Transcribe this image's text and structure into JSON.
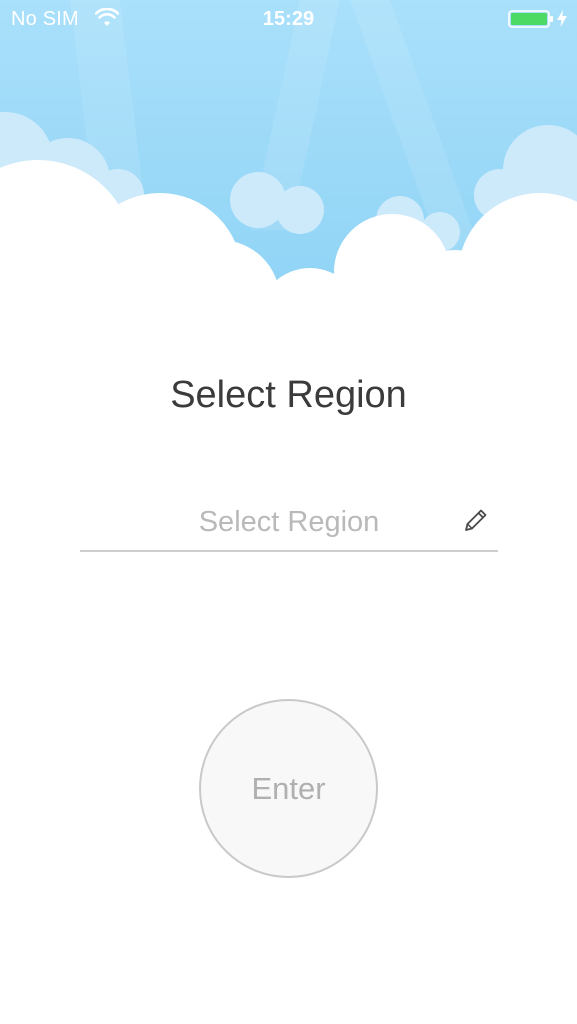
{
  "status_bar": {
    "carrier": "No SIM",
    "time": "15:29",
    "wifi_icon": "wifi-icon",
    "battery_icon": "battery-icon",
    "charging_icon": "lightning-bolt-icon",
    "battery_color": "#4cd964"
  },
  "header": {
    "illustration": "sky-with-clouds",
    "sky_color": "#a3ddf9"
  },
  "main": {
    "title": "Select Region",
    "region_field": {
      "value": "",
      "placeholder": "Select Region",
      "icon": "pencil-icon"
    },
    "enter_button_label": "Enter"
  }
}
